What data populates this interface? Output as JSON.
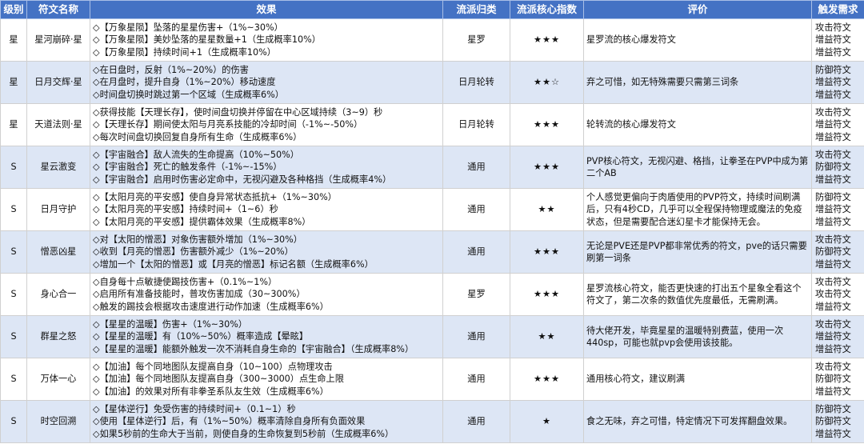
{
  "columns": [
    "级别",
    "符文名称",
    "效果",
    "流派归类",
    "流派核心指数",
    "评价",
    "触发需求"
  ],
  "rows": [
    {
      "level": "星",
      "name": "星河崩碎·星",
      "effects": [
        "◇【万象星陨】坠落的星星伤害+（1%~30%）",
        "◇【万象星陨】美妙坠落的星星数量+1（生成概率10%）",
        "◇【万象星陨】持续时间+1（生成概率10%）"
      ],
      "school": "星罗",
      "rating": "★★★",
      "review": "星罗流的核心爆发符文",
      "triggers": [
        "攻击符文",
        "增益符文",
        "增益符文"
      ]
    },
    {
      "level": "星",
      "name": "日月交辉·星",
      "effects": [
        "◇在日盘时，反射（1%~20%）的伤害",
        "◇在月盘时，提升自身（1%~20%）移动速度",
        "◇时间盘切换时跳过第一个区域（生成概率6%）"
      ],
      "school": "日月轮转",
      "rating": "★★☆",
      "review": "弃之可惜，如无特殊需要只需第三词条",
      "triggers": [
        "防御符文",
        "增益符文",
        "增益符文"
      ]
    },
    {
      "level": "星",
      "name": "天道法则·星",
      "effects": [
        "◇获得技能【天理长存】，使时间盘切换并停留在中心区域持续（3~9）秒",
        "◇【天理长存】期间使太阳与月亮系技能的冷却时间（-1%~-50%）",
        "◇每次时间盘切换回复自身所有生命（生成概率6%）"
      ],
      "school": "日月轮转",
      "rating": "★★★",
      "review": "轮转流的核心爆发符文",
      "triggers": [
        "攻击符文",
        "增益符文",
        "增益符文"
      ]
    },
    {
      "level": "S",
      "name": "星云激变",
      "effects": [
        "◇【宇宙融合】敌人流失的生命提高（10%~50%）",
        "◇【宇宙融合】死亡的触发条件（-1%~-15%）",
        "◇【宇宙融合】启用时伤害必定命中，无视闪避及各种格挡（生成概率4%）"
      ],
      "school": "通用",
      "rating": "★★★",
      "review": "PVP核心符文，无视闪避、格挡，让拳圣在PVP中成为第二个AB",
      "triggers": [
        "攻击符文",
        "防御符文",
        "增益符文"
      ]
    },
    {
      "level": "S",
      "name": "日月守护",
      "effects": [
        "◇【太阳月亮的平安感】使自身异常状态抵抗+（1%~30%）",
        "◇【太阳月亮的平安感】持续时间+（1~6）秒",
        "◇【太阳月亮的平安感】提供霸体效果（生成概率8%）"
      ],
      "school": "通用",
      "rating": "★★",
      "review": "个人感觉更偏向于肉盾使用的PVP符文，持续时间刷满后，只有4秒CD，几乎可以全程保持物理或魔法的免疫状态，但是需要配合迷幻星卡才能保持无会。",
      "triggers": [
        "防御符文",
        "增益符文",
        "增益符文"
      ]
    },
    {
      "level": "S",
      "name": "憎恶凶星",
      "effects": [
        "◇对【太阳的憎恶】对象伤害额外增加（1%~30%）",
        "◇收到【月亮的憎恶】伤害额外减少（1%~20%）",
        "◇增加一个【太阳的憎恶】或【月亮的憎恶】标记名额（生成概率6%）"
      ],
      "school": "通用",
      "rating": "★★★",
      "review": "无论是PVE还是PVP都非常优秀的符文，pve的话只需要刷第一词条",
      "triggers": [
        "攻击符文",
        "防御符文",
        "增益符文"
      ]
    },
    {
      "level": "S",
      "name": "身心合一",
      "effects": [
        "◇自身每十点敏捷使踢技伤害+（0.1%~1%）",
        "◇启用所有准备技能时，普攻伤害加成（30~300%）",
        "◇触发的踢技会根据攻击速度进行动作加速（生成概率6%）"
      ],
      "school": "星罗",
      "rating": "★★★",
      "review": "星罗流核心符文，能否更快速的打出五个星象全看这个符文了，第二次条的数值优先度最低，无需刷满。",
      "triggers": [
        "攻击符文",
        "攻击符文",
        "增益符文"
      ]
    },
    {
      "level": "S",
      "name": "群星之怒",
      "effects": [
        "◇【星星的温暖】伤害+（1%~30%）",
        "◇【星星的温暖】有（10%~50%）概率造成【晕眩】",
        "◇【星星的温暖】能额外触发一次不消耗自身生命的【宇宙融合】（生成概率8%）"
      ],
      "school": "通用",
      "rating": "★★",
      "review": "待大佬开发，毕竟星星的温暖特别费蓝，使用一次440sp，可能也就pvp会使用该技能。",
      "triggers": [
        "攻击符文",
        "增益符文",
        "增益符文"
      ]
    },
    {
      "level": "S",
      "name": "万体一心",
      "effects": [
        "◇【加油】每个同地图队友提高自身（10~100）点物理攻击",
        "◇【加油】每个同地图队友提高自身（300~3000）点生命上限",
        "◇【加油】的效果对所有非拳圣系队友生效（生成概率6%）"
      ],
      "school": "通用",
      "rating": "★★★",
      "review": "通用核心符文，建议刷满",
      "triggers": [
        "攻击符文",
        "防御符文",
        "增益符文"
      ]
    },
    {
      "level": "S",
      "name": "时空回溯",
      "effects": [
        "◇【星体逆行】免受伤害的持续时间+（0.1~1）秒",
        "◇使用【星体逆行】后，有（1%~50%）概率清除自身所有负面效果",
        "◇如果5秒前的生命大于当前，则使自身的生命恢复到5秒前（生成概率6%）"
      ],
      "school": "通用",
      "rating": "★",
      "review": "食之无味，弃之可惜，特定情况下可发挥翻盘效果。",
      "triggers": [
        "防御符文",
        "防御符文",
        "增益符文"
      ]
    }
  ]
}
